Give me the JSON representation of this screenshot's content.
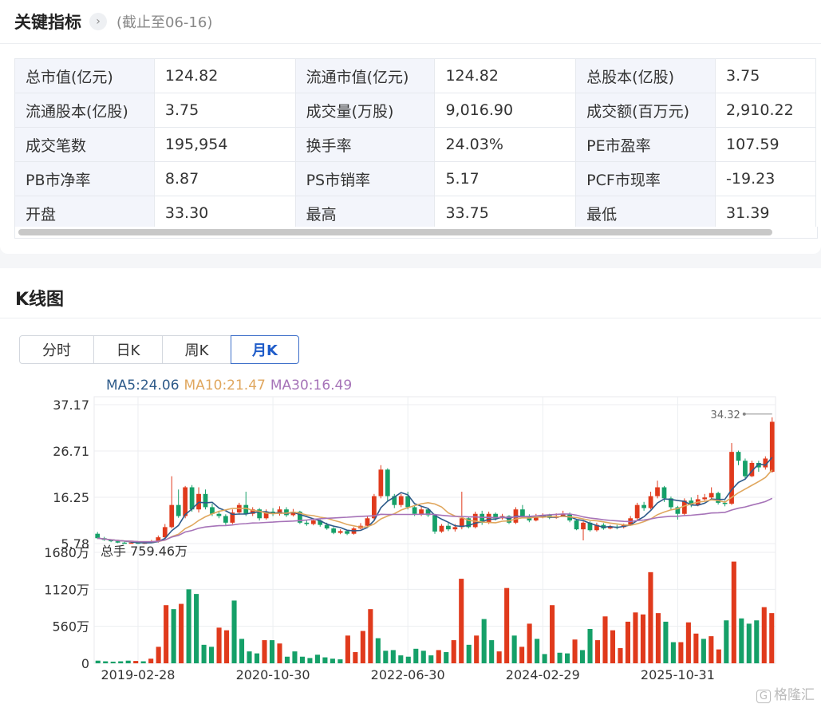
{
  "metrics": {
    "title": "关键指标",
    "date_note": "(截止至06-16)",
    "rows": [
      [
        {
          "label": "总市值(亿元)",
          "value": "124.82"
        },
        {
          "label": "流通市值(亿元)",
          "value": "124.82"
        },
        {
          "label": "总股本(亿股)",
          "value": "3.75"
        }
      ],
      [
        {
          "label": "流通股本(亿股)",
          "value": "3.75"
        },
        {
          "label": "成交量(万股)",
          "value": "9,016.90"
        },
        {
          "label": "成交额(百万元)",
          "value": "2,910.22"
        }
      ],
      [
        {
          "label": "成交笔数",
          "value": "195,954"
        },
        {
          "label": "换手率",
          "value": "24.03%"
        },
        {
          "label": "PE市盈率",
          "value": "107.59"
        }
      ],
      [
        {
          "label": "PB市净率",
          "value": "8.87"
        },
        {
          "label": "PS市销率",
          "value": "5.17"
        },
        {
          "label": "PCF市现率",
          "value": "-19.23"
        }
      ],
      [
        {
          "label": "开盘",
          "value": "33.30"
        },
        {
          "label": "最高",
          "value": "33.75"
        },
        {
          "label": "最低",
          "value": "31.39"
        }
      ]
    ]
  },
  "kline": {
    "title": "K线图",
    "tabs": [
      {
        "label": "分时",
        "active": false
      },
      {
        "label": "日K",
        "active": false
      },
      {
        "label": "周K",
        "active": false
      },
      {
        "label": "月K",
        "active": true
      }
    ],
    "ma_legend": [
      {
        "text": "MA5:24.06",
        "color": "#2e5b8a"
      },
      {
        "text": "MA10:21.47",
        "color": "#e0a75e"
      },
      {
        "text": "MA30:16.49",
        "color": "#a673b8"
      }
    ],
    "max_marker": "34.32",
    "volume_label": "总手 759.46万",
    "watermark": "格隆汇"
  },
  "chart_data": {
    "type": "candlestick",
    "colors": {
      "up": "#e03a1c",
      "down": "#15a068",
      "ma5": "#2e5b8a",
      "ma10": "#e0a75e",
      "ma30": "#a673b8"
    },
    "price_axis_ticks": [
      "37.17",
      "26.71",
      "16.25",
      "5.78"
    ],
    "price_range": [
      5.78,
      37.17
    ],
    "volume_axis_ticks": [
      "1680万",
      "1120万",
      "560万",
      "0"
    ],
    "volume_range": [
      0,
      1680
    ],
    "x_tick_labels": [
      "2019-02-28",
      "2020-10-30",
      "2022-06-30",
      "2024-02-29",
      "2025-10-31"
    ],
    "x_tick_index": [
      6,
      26,
      46,
      66,
      86
    ],
    "ohlc": [
      [
        8.0,
        7.0,
        8.4,
        6.8
      ],
      [
        7.0,
        6.6,
        7.3,
        6.4
      ],
      [
        6.6,
        6.3,
        6.8,
        6.1
      ],
      [
        6.3,
        6.0,
        6.5,
        5.9
      ],
      [
        6.0,
        5.9,
        6.2,
        5.8
      ],
      [
        5.9,
        6.0,
        6.3,
        5.8
      ],
      [
        6.0,
        5.8,
        6.1,
        5.7
      ],
      [
        5.8,
        6.0,
        6.2,
        5.7
      ],
      [
        6.0,
        6.2,
        6.6,
        5.9
      ],
      [
        6.2,
        7.2,
        7.6,
        6.0
      ],
      [
        7.2,
        9.5,
        10.2,
        7.0
      ],
      [
        9.5,
        14.5,
        21.0,
        9.2
      ],
      [
        14.5,
        12.0,
        18.0,
        11.6
      ],
      [
        12.0,
        18.5,
        18.8,
        11.5
      ],
      [
        18.5,
        13.5,
        19.0,
        13.0
      ],
      [
        13.5,
        17.0,
        18.5,
        12.8
      ],
      [
        17.0,
        14.0,
        18.0,
        13.5
      ],
      [
        14.0,
        12.5,
        14.8,
        12.0
      ],
      [
        12.5,
        12.0,
        13.2,
        11.5
      ],
      [
        12.0,
        10.5,
        12.4,
        10.0
      ],
      [
        10.5,
        12.8,
        13.5,
        10.2
      ],
      [
        12.8,
        14.5,
        15.0,
        12.3
      ],
      [
        14.5,
        12.5,
        17.5,
        12.0
      ],
      [
        12.5,
        13.5,
        14.0,
        12.0
      ],
      [
        13.5,
        11.5,
        13.8,
        11.0
      ],
      [
        11.5,
        13.0,
        13.5,
        11.2
      ],
      [
        13.0,
        12.5,
        13.8,
        12.0
      ],
      [
        12.5,
        13.5,
        14.2,
        12.1
      ],
      [
        13.5,
        12.2,
        14.0,
        11.8
      ],
      [
        12.2,
        13.0,
        13.6,
        11.9
      ],
      [
        13.0,
        10.5,
        13.2,
        10.2
      ],
      [
        10.5,
        10.2,
        11.0,
        9.8
      ],
      [
        10.2,
        11.0,
        11.4,
        9.9
      ],
      [
        11.0,
        10.0,
        11.2,
        9.6
      ],
      [
        10.0,
        9.2,
        10.5,
        8.9
      ],
      [
        9.2,
        8.2,
        9.5,
        7.9
      ],
      [
        8.2,
        8.6,
        9.0,
        7.9
      ],
      [
        8.6,
        8.0,
        8.9,
        7.7
      ],
      [
        8.0,
        9.2,
        9.5,
        7.8
      ],
      [
        9.2,
        9.8,
        10.4,
        9.0
      ],
      [
        9.8,
        11.5,
        12.0,
        9.5
      ],
      [
        11.5,
        16.5,
        17.0,
        11.0
      ],
      [
        16.5,
        22.5,
        23.5,
        16.0
      ],
      [
        22.5,
        16.5,
        22.8,
        15.5
      ],
      [
        16.5,
        14.5,
        17.0,
        13.8
      ],
      [
        14.5,
        16.5,
        17.0,
        14.0
      ],
      [
        16.5,
        14.0,
        17.5,
        13.5
      ],
      [
        14.0,
        12.5,
        14.5,
        12.0
      ],
      [
        12.5,
        13.5,
        14.2,
        12.0
      ],
      [
        13.5,
        12.2,
        13.8,
        11.8
      ],
      [
        12.2,
        8.5,
        12.5,
        8.0
      ],
      [
        8.5,
        9.8,
        10.2,
        8.2
      ],
      [
        9.8,
        9.0,
        10.4,
        8.6
      ],
      [
        9.0,
        9.5,
        10.2,
        8.5
      ],
      [
        9.5,
        11.5,
        17.5,
        9.0
      ],
      [
        11.5,
        9.5,
        11.8,
        9.2
      ],
      [
        9.5,
        12.5,
        13.0,
        9.2
      ],
      [
        12.5,
        10.5,
        13.2,
        10.0
      ],
      [
        10.5,
        12.5,
        13.0,
        10.2
      ],
      [
        12.5,
        11.5,
        12.8,
        11.0
      ],
      [
        11.5,
        12.0,
        12.5,
        11.2
      ],
      [
        12.0,
        10.5,
        12.2,
        10.2
      ],
      [
        10.5,
        13.5,
        14.0,
        10.2
      ],
      [
        13.5,
        12.0,
        14.5,
        11.7
      ],
      [
        12.0,
        11.0,
        12.4,
        10.6
      ],
      [
        11.0,
        11.8,
        12.5,
        10.8
      ],
      [
        11.8,
        12.2,
        12.6,
        11.5
      ],
      [
        12.2,
        11.6,
        12.5,
        11.3
      ],
      [
        11.6,
        12.0,
        12.6,
        11.4
      ],
      [
        12.0,
        12.5,
        13.2,
        11.9
      ],
      [
        12.5,
        11.0,
        12.8,
        10.6
      ],
      [
        11.0,
        9.0,
        11.3,
        8.8
      ],
      [
        9.0,
        10.5,
        10.8,
        6.5
      ],
      [
        10.5,
        8.8,
        10.8,
        8.5
      ],
      [
        8.8,
        10.0,
        10.5,
        8.5
      ],
      [
        10.0,
        9.2,
        10.4,
        8.9
      ],
      [
        9.2,
        9.6,
        10.0,
        9.0
      ],
      [
        9.6,
        9.5,
        10.0,
        9.0
      ],
      [
        9.5,
        10.0,
        10.3,
        9.2
      ],
      [
        10.0,
        11.5,
        12.0,
        9.8
      ],
      [
        11.5,
        14.5,
        15.0,
        11.2
      ],
      [
        14.5,
        13.8,
        15.2,
        13.2
      ],
      [
        13.8,
        16.5,
        17.5,
        13.5
      ],
      [
        16.5,
        18.5,
        20.0,
        16.0
      ],
      [
        18.5,
        16.0,
        18.8,
        15.2
      ],
      [
        16.0,
        14.0,
        16.4,
        13.4
      ],
      [
        14.0,
        12.5,
        14.3,
        11.2
      ],
      [
        12.5,
        15.5,
        16.0,
        12.0
      ],
      [
        15.5,
        14.5,
        16.2,
        14.0
      ],
      [
        14.5,
        15.8,
        16.8,
        14.2
      ],
      [
        15.8,
        16.2,
        17.0,
        15.5
      ],
      [
        16.2,
        17.2,
        18.5,
        15.8
      ],
      [
        17.2,
        15.0,
        17.5,
        14.6
      ],
      [
        15.0,
        14.8,
        15.5,
        14.2
      ],
      [
        14.8,
        26.5,
        28.5,
        14.5
      ],
      [
        26.5,
        24.5,
        26.8,
        23.5
      ],
      [
        24.5,
        21.0,
        25.0,
        20.5
      ],
      [
        21.0,
        24.0,
        24.5,
        20.8
      ],
      [
        24.0,
        23.0,
        24.5,
        22.0
      ],
      [
        23.0,
        25.0,
        25.5,
        22.5
      ],
      [
        22.0,
        33.3,
        34.32,
        21.8
      ]
    ],
    "volume_wan": [
      [
        40,
        "down"
      ],
      [
        30,
        "down"
      ],
      [
        25,
        "down"
      ],
      [
        30,
        "down"
      ],
      [
        40,
        "down"
      ],
      [
        35,
        "up"
      ],
      [
        30,
        "down"
      ],
      [
        70,
        "up"
      ],
      [
        250,
        "up"
      ],
      [
        880,
        "up"
      ],
      [
        820,
        "down"
      ],
      [
        900,
        "up"
      ],
      [
        1120,
        "down"
      ],
      [
        1050,
        "down"
      ],
      [
        280,
        "down"
      ],
      [
        250,
        "down"
      ],
      [
        540,
        "up"
      ],
      [
        500,
        "up"
      ],
      [
        950,
        "down"
      ],
      [
        370,
        "down"
      ],
      [
        180,
        "down"
      ],
      [
        150,
        "down"
      ],
      [
        350,
        "up"
      ],
      [
        350,
        "down"
      ],
      [
        300,
        "up"
      ],
      [
        100,
        "down"
      ],
      [
        180,
        "down"
      ],
      [
        100,
        "down"
      ],
      [
        80,
        "down"
      ],
      [
        130,
        "down"
      ],
      [
        90,
        "down"
      ],
      [
        70,
        "down"
      ],
      [
        60,
        "down"
      ],
      [
        420,
        "up"
      ],
      [
        170,
        "up"
      ],
      [
        490,
        "up"
      ],
      [
        820,
        "up"
      ],
      [
        380,
        "down"
      ],
      [
        190,
        "down"
      ],
      [
        200,
        "down"
      ],
      [
        120,
        "down"
      ],
      [
        100,
        "down"
      ],
      [
        220,
        "down"
      ],
      [
        190,
        "down"
      ],
      [
        120,
        "down"
      ],
      [
        200,
        "up"
      ],
      [
        170,
        "down"
      ],
      [
        350,
        "up"
      ],
      [
        1280,
        "up"
      ],
      [
        280,
        "down"
      ],
      [
        420,
        "up"
      ],
      [
        670,
        "down"
      ],
      [
        350,
        "down"
      ],
      [
        180,
        "up"
      ],
      [
        1140,
        "up"
      ],
      [
        420,
        "down"
      ],
      [
        250,
        "up"
      ],
      [
        600,
        "up"
      ],
      [
        370,
        "down"
      ],
      [
        140,
        "down"
      ],
      [
        880,
        "up"
      ],
      [
        160,
        "down"
      ],
      [
        150,
        "down"
      ],
      [
        360,
        "up"
      ],
      [
        200,
        "down"
      ],
      [
        520,
        "down"
      ],
      [
        350,
        "up"
      ],
      [
        710,
        "up"
      ],
      [
        500,
        "up"
      ],
      [
        230,
        "up"
      ],
      [
        630,
        "up"
      ],
      [
        770,
        "up"
      ],
      [
        740,
        "up"
      ],
      [
        1380,
        "up"
      ],
      [
        760,
        "up"
      ],
      [
        630,
        "down"
      ],
      [
        320,
        "down"
      ],
      [
        320,
        "up"
      ],
      [
        620,
        "up"
      ],
      [
        450,
        "up"
      ],
      [
        370,
        "down"
      ],
      [
        410,
        "up"
      ],
      [
        210,
        "up"
      ],
      [
        650,
        "down"
      ],
      [
        1540,
        "up"
      ],
      [
        680,
        "down"
      ],
      [
        600,
        "down"
      ],
      [
        650,
        "down"
      ],
      [
        850,
        "up"
      ],
      [
        760,
        "up"
      ]
    ]
  }
}
